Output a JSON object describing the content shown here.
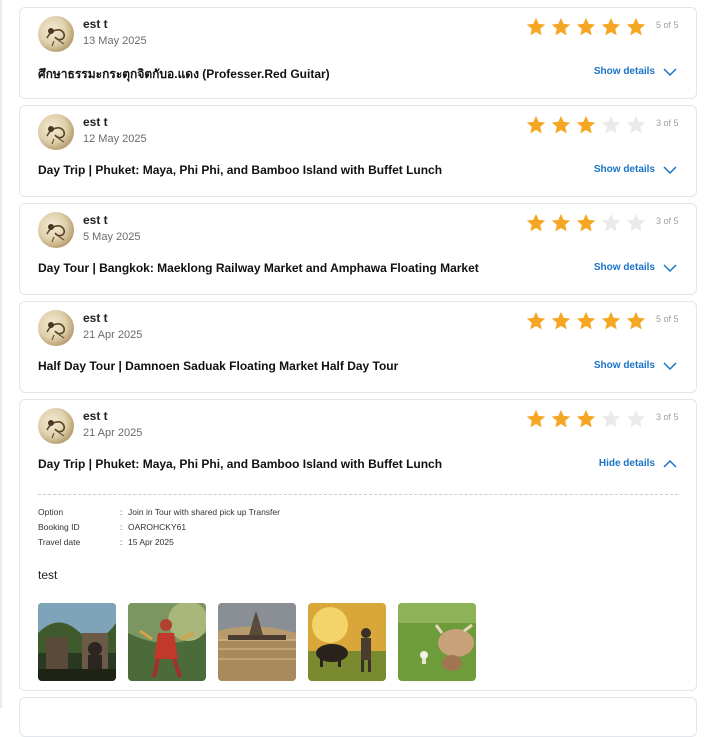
{
  "reviews": [
    {
      "reviewer": "est  t",
      "date": "13 May 2025",
      "rating": 5,
      "rating_text": "5 of 5",
      "title": "ศึกษาธรรมะกระตุกจิตกับอ.แดง (Professer.Red Guitar)",
      "toggle_label": "Show details"
    },
    {
      "reviewer": "est  t",
      "date": "12 May 2025",
      "rating": 3,
      "rating_text": "3 of 5",
      "title": "Day Trip | Phuket: Maya, Phi Phi, and Bamboo Island with Buffet Lunch",
      "toggle_label": "Show details"
    },
    {
      "reviewer": "est  t",
      "date": "5 May 2025",
      "rating": 3,
      "rating_text": "3 of 5",
      "title": "Day Tour | Bangkok: Maeklong Railway Market and Amphawa Floating Market",
      "toggle_label": "Show details"
    },
    {
      "reviewer": "est  t",
      "date": "21 Apr 2025",
      "rating": 5,
      "rating_text": "5 of 5",
      "title": "Half Day Tour | Damnoen Saduak Floating Market Half Day Tour",
      "toggle_label": "Show details"
    },
    {
      "reviewer": "est  t",
      "date": "21 Apr 2025",
      "rating": 3,
      "rating_text": "3 of 5",
      "title": "Day Trip | Phuket: Maya, Phi Phi, and Bamboo Island with Buffet Lunch",
      "toggle_label": "Hide details",
      "details": {
        "option_label": "Option",
        "option_value": "Join in Tour with shared pick up Transfer",
        "booking_label": "Booking ID",
        "booking_value": "OAROHCKY61",
        "travel_label": "Travel date",
        "travel_value": "15 Apr 2025",
        "colon": ":",
        "review_text": "test",
        "photos": [
          "temple-buddha-photo",
          "thai-dancer-photo",
          "temple-river-sunset-photo",
          "farmer-buffalo-photo",
          "cow-field-photo"
        ]
      }
    }
  ],
  "colors": {
    "star_active": "#f5a623",
    "star_inactive": "#e9eaec",
    "link": "#1a73c9"
  }
}
